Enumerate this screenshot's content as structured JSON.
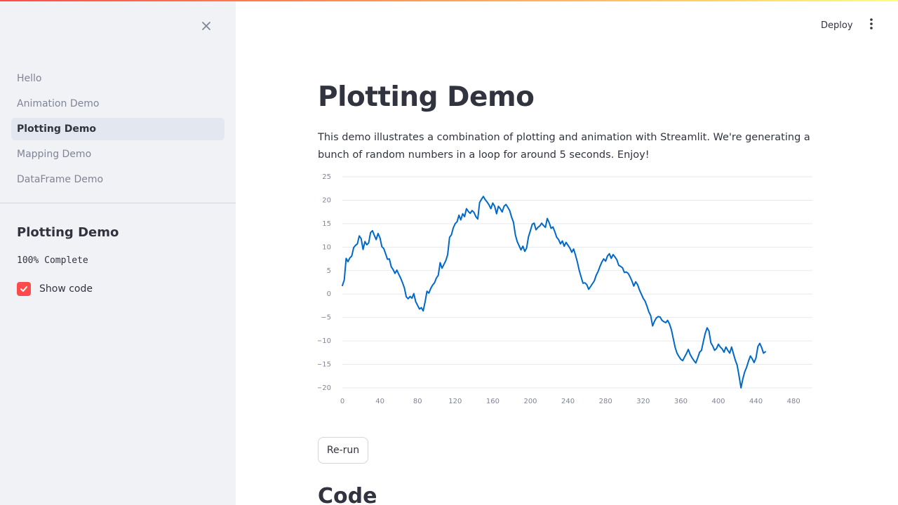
{
  "sidebar": {
    "close_icon": "close-icon",
    "nav_items": [
      {
        "label": "Hello",
        "active": false
      },
      {
        "label": "Animation Demo",
        "active": false
      },
      {
        "label": "Plotting Demo",
        "active": true
      },
      {
        "label": "Mapping Demo",
        "active": false
      },
      {
        "label": "DataFrame Demo",
        "active": false
      }
    ],
    "title": "Plotting Demo",
    "progress_text": "100% Complete",
    "show_code": {
      "label": "Show code",
      "checked": true
    }
  },
  "header": {
    "deploy_label": "Deploy",
    "menu_icon": "more-vertical-icon"
  },
  "main": {
    "title": "Plotting Demo",
    "description": "This demo illustrates a combination of plotting and animation with Streamlit. We're generating a bunch of random numbers in a loop for around 5 seconds. Enjoy!",
    "rerun_label": "Re-run",
    "code_heading": "Code"
  },
  "colors": {
    "accent": "#ff4b4b",
    "line": "#0068c9",
    "sidebar_bg": "#f0f2f6",
    "active_item_bg": "#e3e7ef"
  },
  "chart_data": {
    "type": "line",
    "xlim": [
      0,
      500
    ],
    "ylim": [
      -20,
      25
    ],
    "x_ticks": [
      0,
      40,
      80,
      120,
      160,
      200,
      240,
      280,
      320,
      360,
      400,
      440,
      480
    ],
    "y_ticks": [
      25,
      20,
      15,
      10,
      5,
      0,
      -5,
      -10,
      -15,
      -20
    ],
    "y_tick_labels": [
      "25",
      "20",
      "15",
      "10",
      "5",
      "0",
      "−5",
      "−10",
      "−15",
      "−20"
    ],
    "grid": true,
    "x": [
      0,
      2,
      4,
      6,
      8,
      10,
      12,
      14,
      16,
      18,
      20,
      22,
      24,
      26,
      28,
      30,
      32,
      34,
      36,
      38,
      40,
      42,
      44,
      46,
      48,
      50,
      52,
      54,
      56,
      58,
      60,
      62,
      64,
      66,
      68,
      70,
      72,
      74,
      76,
      78,
      80,
      82,
      84,
      86,
      88,
      90,
      92,
      94,
      96,
      98,
      100,
      102,
      104,
      106,
      108,
      110,
      112,
      114,
      116,
      118,
      120,
      122,
      124,
      126,
      128,
      130,
      132,
      134,
      136,
      138,
      140,
      142,
      144,
      146,
      148,
      150,
      152,
      154,
      156,
      158,
      160,
      162,
      164,
      166,
      168,
      170,
      172,
      174,
      176,
      178,
      180,
      182,
      184,
      186,
      188,
      190,
      192,
      194,
      196,
      198,
      200,
      202,
      204,
      206,
      208,
      210,
      212,
      214,
      216,
      218,
      220,
      222,
      224,
      226,
      228,
      230,
      232,
      234,
      236,
      238,
      240,
      242,
      244,
      246,
      248,
      250,
      252,
      254,
      256,
      258,
      260,
      262,
      264,
      266,
      268,
      270,
      272,
      274,
      276,
      278,
      280,
      282,
      284,
      286,
      288,
      290,
      292,
      294,
      296,
      298,
      300,
      302,
      304,
      306,
      308,
      310,
      312,
      314,
      316,
      318,
      320,
      322,
      324,
      326,
      328,
      330,
      332,
      334,
      336,
      338,
      340,
      342,
      344,
      346,
      348,
      350,
      352,
      354,
      356,
      358,
      360,
      362,
      364,
      366,
      368,
      370,
      372,
      374,
      376,
      378,
      380,
      382,
      384,
      386,
      388,
      390,
      392,
      394,
      396,
      398,
      400,
      402,
      404,
      406,
      408,
      410,
      412,
      414,
      416,
      418,
      420,
      422,
      424,
      426,
      428,
      430,
      432,
      434,
      436,
      438,
      440,
      442,
      444,
      446,
      448,
      450,
      452,
      454,
      456,
      458,
      460,
      462,
      464,
      466,
      468,
      470,
      472,
      474,
      476,
      478,
      480,
      482,
      484,
      486,
      488,
      490,
      492,
      494,
      496,
      498,
      500
    ],
    "series": [
      {
        "values": [
          1.8,
          3.0,
          7.6,
          6.9,
          7.7,
          8.1,
          9.9,
          10.4,
          10.7,
          12.4,
          11.8,
          9.5,
          11.2,
          10.5,
          10.9,
          13.1,
          13.5,
          12.5,
          11.6,
          12.9,
          12.0,
          10.1,
          9.7,
          8.6,
          7.4,
          7.5,
          5.8,
          5.2,
          4.4,
          5.1,
          4.2,
          3.4,
          2.4,
          1.3,
          -0.6,
          -1.0,
          -0.5,
          -0.9,
          0.1,
          -1.6,
          -2.4,
          -3.2,
          -2.9,
          -3.6,
          -1.7,
          0.6,
          0.2,
          1.2,
          1.9,
          2.4,
          3.4,
          4.0,
          6.7,
          5.5,
          6.3,
          7.1,
          8.4,
          12.1,
          12.6,
          14.1,
          15.0,
          15.4,
          16.8,
          15.8,
          17.1,
          16.5,
          18.2,
          17.6,
          17.2,
          17.8,
          17.4,
          16.5,
          16.0,
          19.5,
          20.2,
          20.8,
          20.1,
          19.6,
          19.0,
          18.2,
          19.4,
          18.7,
          17.1,
          18.7,
          18.2,
          17.5,
          18.7,
          19.1,
          18.5,
          17.8,
          16.4,
          15.3,
          12.6,
          11.2,
          10.3,
          9.4,
          10.2,
          9.1,
          9.8,
          12.2,
          13.5,
          14.9,
          15.1,
          13.7,
          14.2,
          14.5,
          15.1,
          14.6,
          14.2,
          16.1,
          15.2,
          14.0,
          14.3,
          13.3,
          12.1,
          11.6,
          10.7,
          11.3,
          10.2,
          11.0,
          10.4,
          9.8,
          8.9,
          9.6,
          8.3,
          6.8,
          5.0,
          3.6,
          2.3,
          2.4,
          2.0,
          1.0,
          1.6,
          2.2,
          2.8,
          4.0,
          4.8,
          5.9,
          6.8,
          7.5,
          7.0,
          8.1,
          8.6,
          7.6,
          8.4,
          7.9,
          7.3,
          6.1,
          5.9,
          5.6,
          4.6,
          4.7,
          4.4,
          3.7,
          2.8,
          1.7,
          2.6,
          2.0,
          0.9,
          0.0,
          -0.9,
          -1.5,
          -2.6,
          -3.8,
          -4.6,
          -6.8,
          -5.8,
          -5.1,
          -4.8,
          -4.9,
          -5.6,
          -5.9,
          -6.1,
          -5.6,
          -6.4,
          -7.6,
          -9.5,
          -11.4,
          -12.6,
          -13.3,
          -13.9,
          -14.2,
          -13.4,
          -12.7,
          -11.8,
          -12.9,
          -13.6,
          -14.2,
          -14.7,
          -13.6,
          -12.4,
          -12.0,
          -10.1,
          -8.4,
          -7.2,
          -7.9,
          -10.4,
          -11.1,
          -12.0,
          -11.6,
          -10.7,
          -11.3,
          -11.7,
          -12.4,
          -11.3,
          -12.0,
          -12.6,
          -11.3,
          -12.7,
          -14.1,
          -15.2,
          -17.5,
          -20.0,
          -18.1,
          -16.6,
          -15.6,
          -14.3,
          -13.2,
          -13.8,
          -14.6,
          -13.6,
          -11.2,
          -10.5,
          -11.4,
          -12.6,
          -12.3
        ]
      }
    ]
  }
}
